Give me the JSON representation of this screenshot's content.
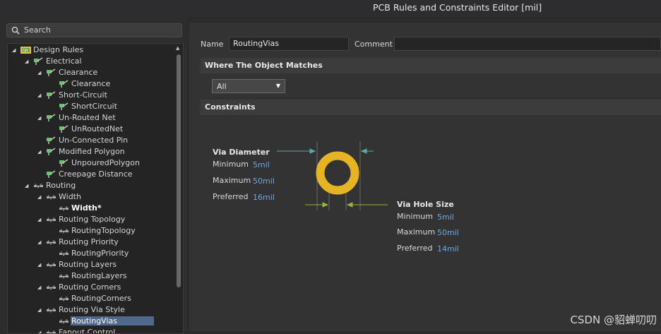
{
  "window": {
    "title": "PCB Rules and Constraints Editor [mil]"
  },
  "search": {
    "placeholder": "Search"
  },
  "tree": {
    "items": [
      {
        "label": "Design Rules",
        "expander": "◢",
        "icon": "design-rules-icon"
      },
      {
        "label": "Electrical",
        "expander": "◢",
        "icon": "rule-category-icon"
      },
      {
        "label": "Clearance",
        "expander": "◢",
        "icon": "rule-category-icon"
      },
      {
        "label": "Clearance",
        "expander": "",
        "icon": "rule-icon"
      },
      {
        "label": "Short-Circuit",
        "expander": "◢",
        "icon": "rule-category-icon"
      },
      {
        "label": "ShortCircuit",
        "expander": "",
        "icon": "rule-icon"
      },
      {
        "label": "Un-Routed Net",
        "expander": "◢",
        "icon": "rule-category-icon"
      },
      {
        "label": "UnRoutedNet",
        "expander": "",
        "icon": "rule-icon"
      },
      {
        "label": "Un-Connected Pin",
        "expander": "",
        "icon": "rule-category-icon"
      },
      {
        "label": "Modified Polygon",
        "expander": "◢",
        "icon": "rule-category-icon"
      },
      {
        "label": "UnpouredPolygon",
        "expander": "",
        "icon": "rule-icon"
      },
      {
        "label": "Creepage Distance",
        "expander": "",
        "icon": "rule-category-icon"
      },
      {
        "label": "Routing",
        "expander": "◢",
        "icon": "routing-category-icon"
      },
      {
        "label": "Width",
        "expander": "◢",
        "icon": "routing-category-icon"
      },
      {
        "label": "Width*",
        "expander": "",
        "icon": "routing-rule-icon"
      },
      {
        "label": "Routing Topology",
        "expander": "◢",
        "icon": "routing-category-icon"
      },
      {
        "label": "RoutingTopology",
        "expander": "",
        "icon": "routing-rule-icon"
      },
      {
        "label": "Routing Priority",
        "expander": "◢",
        "icon": "routing-category-icon"
      },
      {
        "label": "RoutingPriority",
        "expander": "",
        "icon": "routing-rule-icon"
      },
      {
        "label": "Routing Layers",
        "expander": "◢",
        "icon": "routing-category-icon"
      },
      {
        "label": "RoutingLayers",
        "expander": "",
        "icon": "routing-rule-icon"
      },
      {
        "label": "Routing Corners",
        "expander": "◢",
        "icon": "routing-category-icon"
      },
      {
        "label": "RoutingCorners",
        "expander": "",
        "icon": "routing-rule-icon"
      },
      {
        "label": "Routing Via Style",
        "expander": "◢",
        "icon": "routing-category-icon"
      },
      {
        "label": "RoutingVias",
        "expander": "",
        "icon": "routing-rule-icon"
      },
      {
        "label": "Fanout Control",
        "expander": "◢",
        "icon": "routing-category-icon"
      }
    ]
  },
  "rule": {
    "name_label": "Name",
    "name_value": "RoutingVias",
    "comment_label": "Comment",
    "comment_value": ""
  },
  "where": {
    "header": "Where The Object Matches",
    "selected": "All"
  },
  "constraints": {
    "header": "Constraints",
    "via_diameter": {
      "title": "Via Diameter",
      "minimum_label": "Minimum",
      "minimum": "5mil",
      "maximum_label": "Maximum",
      "maximum": "50mil",
      "preferred_label": "Preferred",
      "preferred": "16mil"
    },
    "via_hole": {
      "title": "Via Hole Size",
      "minimum_label": "Minimum",
      "minimum": "5mil",
      "maximum_label": "Maximum",
      "maximum": "50mil",
      "preferred_label": "Preferred",
      "preferred": "14mil"
    }
  },
  "colors": {
    "via_ring": "#e6b422",
    "selection": "#50698a",
    "value_link": "#6fa8dc"
  },
  "watermark": "CSDN @貂蝉叨叨"
}
